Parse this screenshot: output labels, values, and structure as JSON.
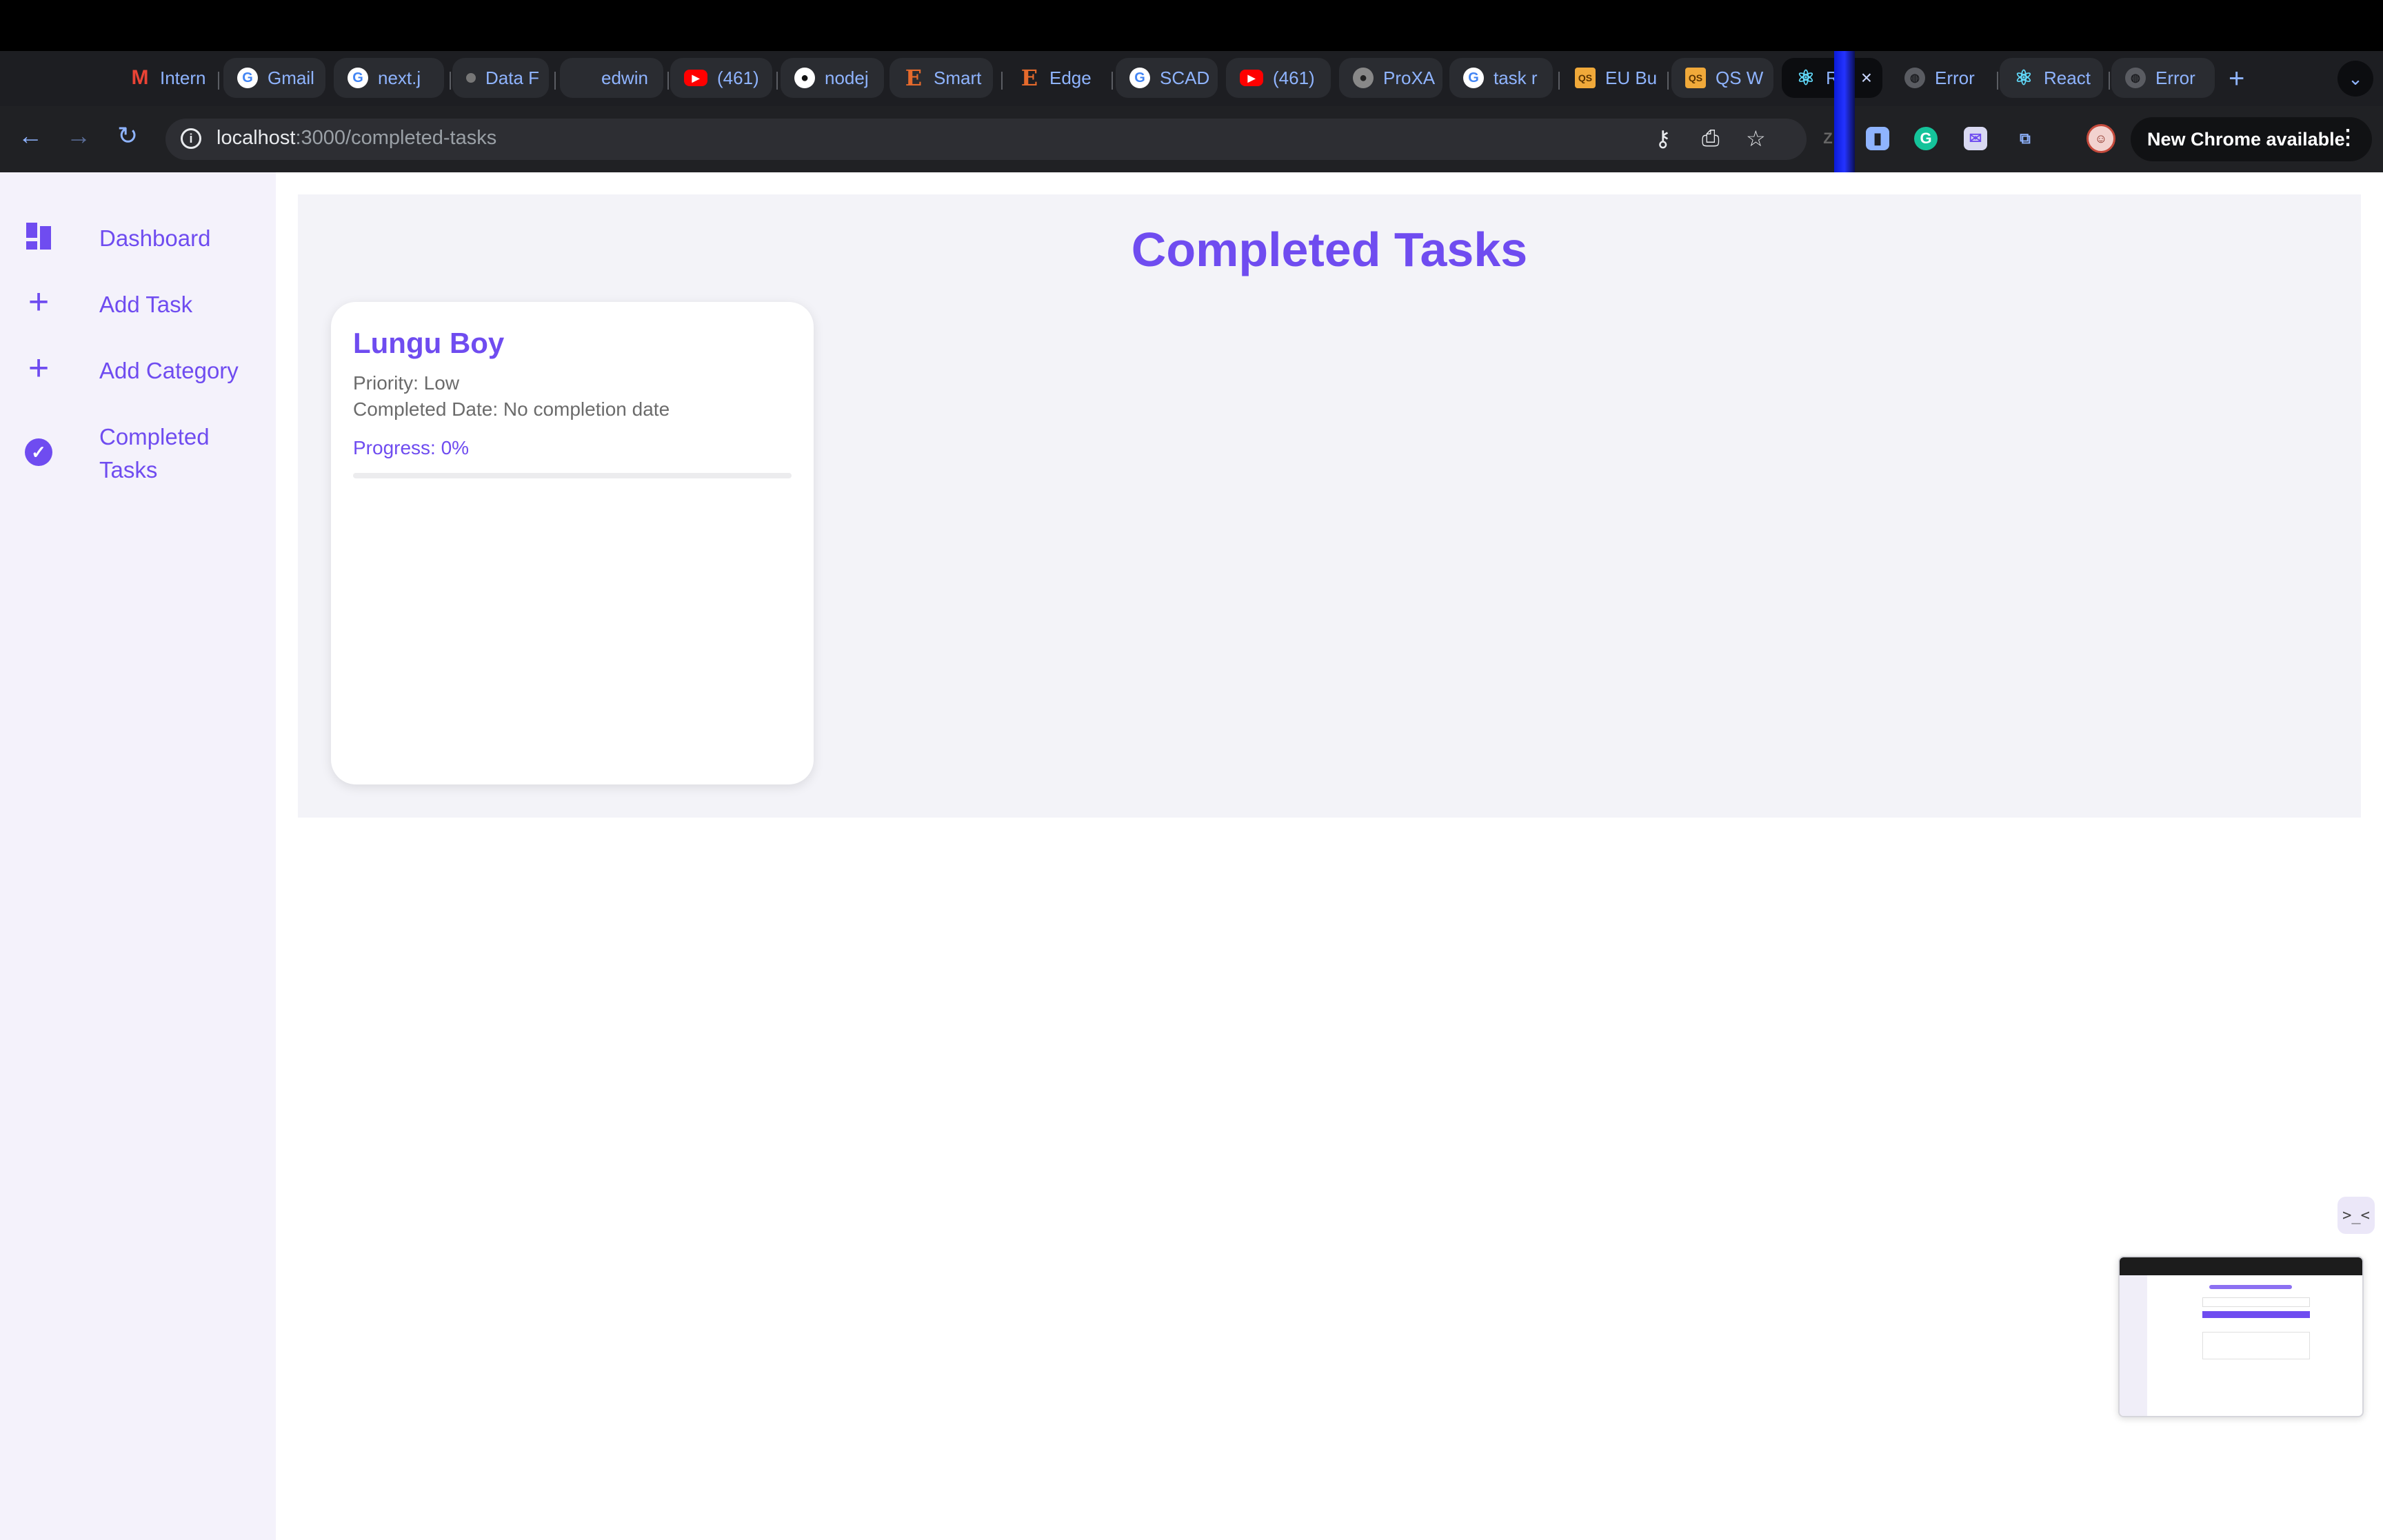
{
  "browser": {
    "tabs": [
      {
        "label": "Intern",
        "icon": "gmail-icon"
      },
      {
        "label": "Gmail",
        "icon": "google-icon"
      },
      {
        "label": "next.j",
        "icon": "google-icon"
      },
      {
        "label": "Data F",
        "icon": "generic-icon"
      },
      {
        "label": "edwin",
        "icon": "generic-icon"
      },
      {
        "label": "(461)",
        "icon": "youtube-icon"
      },
      {
        "label": "nodej",
        "icon": "github-icon"
      },
      {
        "label": "Smart",
        "icon": "e-logo-icon"
      },
      {
        "label": "Edge",
        "icon": "e-logo-icon"
      },
      {
        "label": "SCAD",
        "icon": "google-icon"
      },
      {
        "label": "(461)",
        "icon": "youtube-icon"
      },
      {
        "label": "ProXA",
        "icon": "github-icon"
      },
      {
        "label": "task r",
        "icon": "google-icon"
      },
      {
        "label": "EU Bu",
        "icon": "qs-icon"
      },
      {
        "label": "QS W",
        "icon": "qs-icon"
      },
      {
        "label": "R",
        "icon": "react-icon"
      },
      {
        "label": "Error",
        "icon": "globe-icon"
      },
      {
        "label": "React",
        "icon": "react-icon"
      },
      {
        "label": "Error",
        "icon": "globe-icon"
      }
    ],
    "url_host": "localhost",
    "url_path": ":3000/completed-tasks",
    "update_label": "New Chrome available"
  },
  "sidebar": {
    "items": [
      {
        "label": "Dashboard",
        "icon": "dashboard-icon"
      },
      {
        "label": "Add Task",
        "icon": "plus-icon"
      },
      {
        "label": "Add Category",
        "icon": "plus-icon"
      },
      {
        "label": "Completed Tasks",
        "icon": "check-circle-icon"
      }
    ]
  },
  "main": {
    "title": "Completed Tasks",
    "tasks": [
      {
        "title": "Lungu Boy",
        "priority": "Priority: Low",
        "completed_date": "Completed Date: No completion date",
        "progress_label": "Progress: 0%",
        "progress": 0
      }
    ]
  },
  "floating": {
    "toggle_label": ">_<"
  },
  "colors": {
    "accent": "#6f4cf0",
    "sidebar_bg": "#f4f2fb",
    "panel_bg": "#f3f3f8"
  }
}
